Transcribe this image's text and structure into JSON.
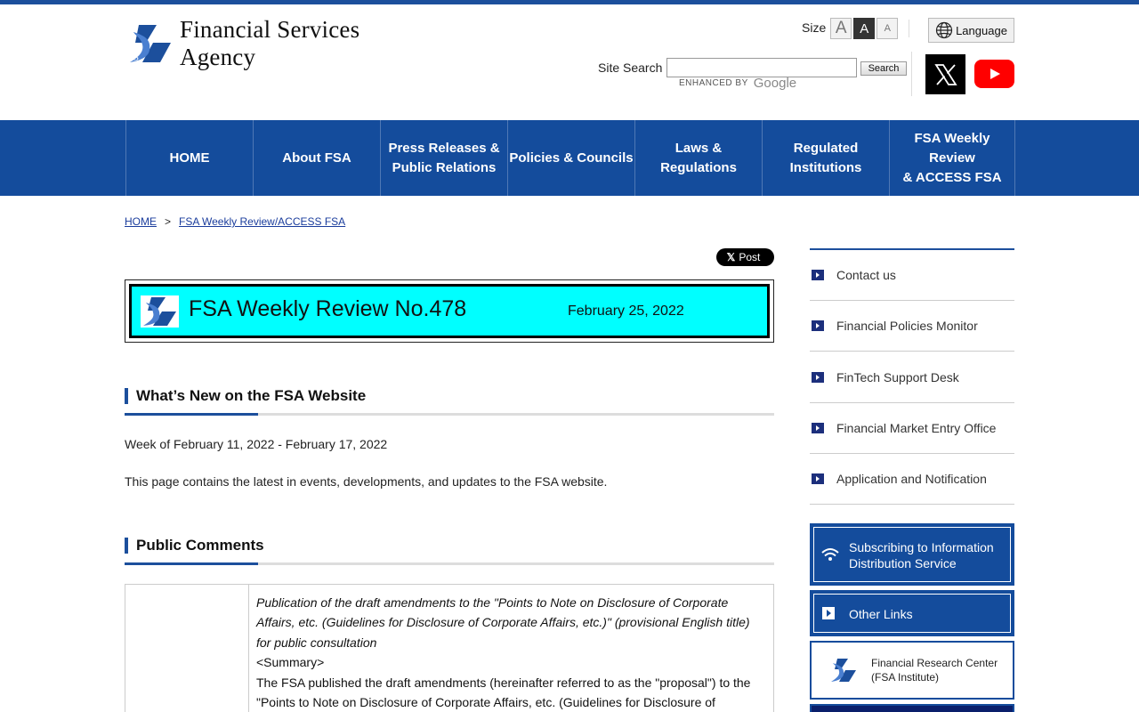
{
  "header": {
    "logo_text": "Financial Services Agency",
    "size_label": "Size",
    "size_buttons": [
      "A",
      "A",
      "A"
    ],
    "language_label": "Language",
    "search_label": "Site Search",
    "search_value": "",
    "search_button": "Search",
    "enhanced_by": "ENHANCED BY",
    "google": "Google"
  },
  "nav": {
    "items": [
      "HOME",
      "About FSA",
      "Press Releases &\nPublic Relations",
      "Policies & Councils",
      "Laws &\nRegulations",
      "Regulated\nInstitutions",
      "FSA Weekly Review\n& ACCESS FSA"
    ]
  },
  "breadcrumb": {
    "home": "HOME",
    "separator": ">",
    "current": "FSA Weekly Review/ACCESS FSA"
  },
  "post_button": {
    "icon": "x-logo",
    "label": "Post",
    "glyph": "𝕏"
  },
  "banner": {
    "title": "FSA Weekly Review No.478",
    "date": "February 25, 2022"
  },
  "whats_new": {
    "heading": "What’s New on the FSA Website",
    "week": "Week of February 11, 2022 - February 17, 2022",
    "intro": "This page contains the latest in events, developments, and updates to the FSA website."
  },
  "public_comments": {
    "heading": "Public Comments",
    "title_italic": "Publication of the draft amendments to the \"Points to Note on Disclosure of Corporate Affairs, etc. (Guidelines for Disclosure of Corporate Affairs, etc.)\" (provisional English title) for public consultation",
    "summary_label": "<Summary>",
    "summary_text": "The FSA published the draft amendments (hereinafter referred to as the \"proposal\") to the \"Points to Note on Disclosure of Corporate Affairs, etc. (Guidelines for Disclosure of"
  },
  "sidebar": {
    "items": [
      "Contact us",
      "Financial Policies Monitor",
      "FinTech Support Desk",
      "Financial Market Entry Office",
      "Application and Notification"
    ],
    "subscribe": "Subscribing to Information Distribution Service",
    "other_links": "Other Links",
    "frc_line1": "Financial Research Center",
    "frc_line2": "(FSA Institute)"
  },
  "colors": {
    "brand_blue": "#144c9c",
    "banner_cyan": "#00ffff",
    "youtube_red": "#ff0000"
  }
}
